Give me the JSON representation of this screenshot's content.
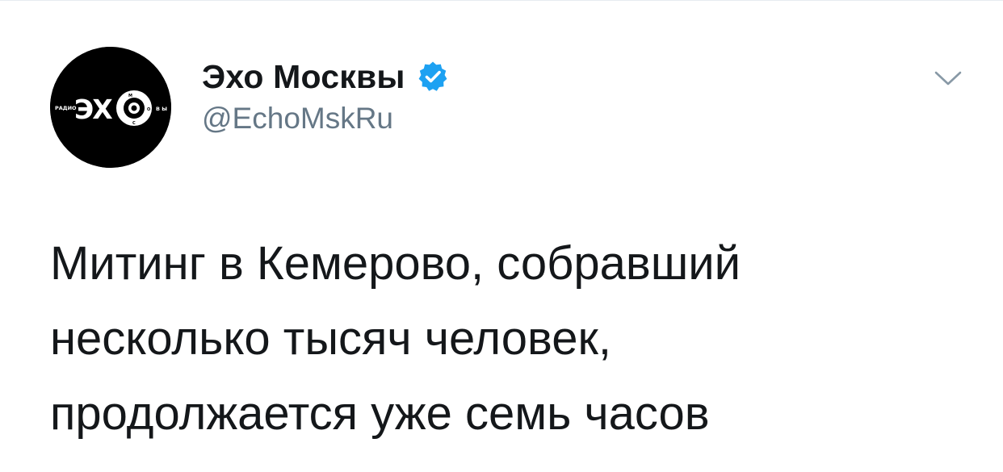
{
  "author": {
    "display_name": "Эхо Москвы",
    "handle": "@EchoMskRu",
    "verified": true,
    "avatar_logo_text": {
      "left": "РАДИО",
      "main": "ЭХО",
      "right": "ВЫ",
      "ring": "МОС"
    }
  },
  "tweet": {
    "lines": [
      "Митинг в Кемерово, собравший",
      "несколько тысяч человек,",
      "продолжается уже семь часов"
    ]
  },
  "icons": {
    "verified": "verified-badge-icon",
    "menu": "chevron-down-icon"
  },
  "colors": {
    "text_primary": "#14171a",
    "text_secondary": "#657786",
    "verified_blue": "#1da1f2",
    "avatar_bg": "#000000",
    "divider": "#e6ecf0"
  }
}
